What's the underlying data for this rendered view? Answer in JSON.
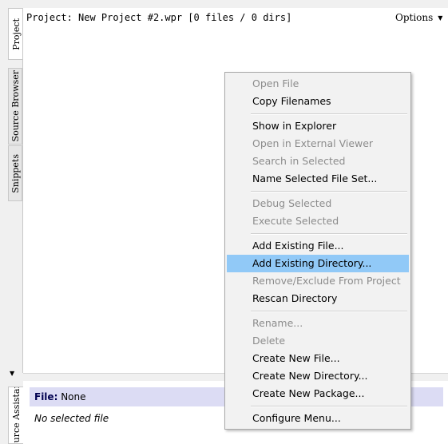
{
  "project_panel": {
    "header": "Project: New Project #2.wpr [0 files / 0 dirs]",
    "options_label": "Options",
    "options_arrow": "▼"
  },
  "tabs": {
    "project": "Project",
    "source_browser": "Source Browser",
    "snippets": "Snippets",
    "source_assistant": "Source Assistant"
  },
  "collapse_arrow": "▼",
  "source_assistant": {
    "file_label": "File:",
    "file_value": "None",
    "status": "No selected file"
  },
  "context_menu": {
    "open_file": "Open File",
    "copy_filenames": "Copy Filenames",
    "show_in_explorer": "Show in Explorer",
    "open_external": "Open in External Viewer",
    "search_selected": "Search in Selected",
    "name_file_set": "Name Selected File Set...",
    "debug_selected": "Debug Selected",
    "execute_selected": "Execute Selected",
    "add_existing_file": "Add Existing File...",
    "add_existing_directory": "Add Existing Directory...",
    "remove_exclude": "Remove/Exclude From Project",
    "rescan_directory": "Rescan Directory",
    "rename": "Rename...",
    "delete": "Delete",
    "create_new_file": "Create New File...",
    "create_new_directory": "Create New Directory...",
    "create_new_package": "Create New Package...",
    "configure_menu": "Configure Menu..."
  }
}
